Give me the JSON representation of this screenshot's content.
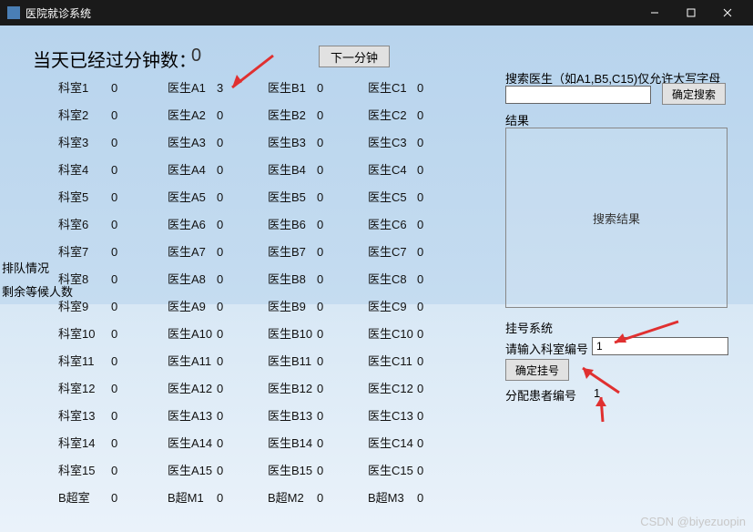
{
  "window": {
    "title": "医院就诊系统"
  },
  "minutes": {
    "label": "当天已经过分钟数：",
    "value": "0"
  },
  "next_minute_btn": "下一分钟",
  "side": {
    "line1": "排队情况",
    "line2": "剩余等候人数"
  },
  "rooms": [
    {
      "name": "科室1",
      "val": "0"
    },
    {
      "name": "科室2",
      "val": "0"
    },
    {
      "name": "科室3",
      "val": "0"
    },
    {
      "name": "科室4",
      "val": "0"
    },
    {
      "name": "科室5",
      "val": "0"
    },
    {
      "name": "科室6",
      "val": "0"
    },
    {
      "name": "科室7",
      "val": "0"
    },
    {
      "name": "科室8",
      "val": "0"
    },
    {
      "name": "科室9",
      "val": "0"
    },
    {
      "name": "科室10",
      "val": "0"
    },
    {
      "name": "科室11",
      "val": "0"
    },
    {
      "name": "科室12",
      "val": "0"
    },
    {
      "name": "科室13",
      "val": "0"
    },
    {
      "name": "科室14",
      "val": "0"
    },
    {
      "name": "科室15",
      "val": "0"
    },
    {
      "name": "B超室",
      "val": "0"
    }
  ],
  "docA": [
    {
      "name": "医生A1",
      "val": "3"
    },
    {
      "name": "医生A2",
      "val": "0"
    },
    {
      "name": "医生A3",
      "val": "0"
    },
    {
      "name": "医生A4",
      "val": "0"
    },
    {
      "name": "医生A5",
      "val": "0"
    },
    {
      "name": "医生A6",
      "val": "0"
    },
    {
      "name": "医生A7",
      "val": "0"
    },
    {
      "name": "医生A8",
      "val": "0"
    },
    {
      "name": "医生A9",
      "val": "0"
    },
    {
      "name": "医生A10",
      "val": "0"
    },
    {
      "name": "医生A11",
      "val": "0"
    },
    {
      "name": "医生A12",
      "val": "0"
    },
    {
      "name": "医生A13",
      "val": "0"
    },
    {
      "name": "医生A14",
      "val": "0"
    },
    {
      "name": "医生A15",
      "val": "0"
    },
    {
      "name": "B超M1",
      "val": "0"
    }
  ],
  "docB": [
    {
      "name": "医生B1",
      "val": "0"
    },
    {
      "name": "医生B2",
      "val": "0"
    },
    {
      "name": "医生B3",
      "val": "0"
    },
    {
      "name": "医生B4",
      "val": "0"
    },
    {
      "name": "医生B5",
      "val": "0"
    },
    {
      "name": "医生B6",
      "val": "0"
    },
    {
      "name": "医生B7",
      "val": "0"
    },
    {
      "name": "医生B8",
      "val": "0"
    },
    {
      "name": "医生B9",
      "val": "0"
    },
    {
      "name": "医生B10",
      "val": "0"
    },
    {
      "name": "医生B11",
      "val": "0"
    },
    {
      "name": "医生B12",
      "val": "0"
    },
    {
      "name": "医生B13",
      "val": "0"
    },
    {
      "name": "医生B14",
      "val": "0"
    },
    {
      "name": "医生B15",
      "val": "0"
    },
    {
      "name": "B超M2",
      "val": "0"
    }
  ],
  "docC": [
    {
      "name": "医生C1",
      "val": "0"
    },
    {
      "name": "医生C2",
      "val": "0"
    },
    {
      "name": "医生C3",
      "val": "0"
    },
    {
      "name": "医生C4",
      "val": "0"
    },
    {
      "name": "医生C5",
      "val": "0"
    },
    {
      "name": "医生C6",
      "val": "0"
    },
    {
      "name": "医生C7",
      "val": "0"
    },
    {
      "name": "医生C8",
      "val": "0"
    },
    {
      "name": "医生C9",
      "val": "0"
    },
    {
      "name": "医生C10",
      "val": "0"
    },
    {
      "name": "医生C11",
      "val": "0"
    },
    {
      "name": "医生C12",
      "val": "0"
    },
    {
      "name": "医生C13",
      "val": "0"
    },
    {
      "name": "医生C14",
      "val": "0"
    },
    {
      "name": "医生C15",
      "val": "0"
    },
    {
      "name": "B超M3",
      "val": "0"
    }
  ],
  "search": {
    "label": "搜索医生（如A1,B5,C15)仅允许大写字母",
    "btn": "确定搜索",
    "result_label": "结果",
    "result_placeholder": "搜索结果"
  },
  "register": {
    "section_label": "挂号系统",
    "input_label": "请输入科室编号",
    "input_value": "1",
    "btn": "确定挂号",
    "assign_label": "分配患者编号",
    "assign_value": "1"
  },
  "watermark": "CSDN @biyezuopin"
}
